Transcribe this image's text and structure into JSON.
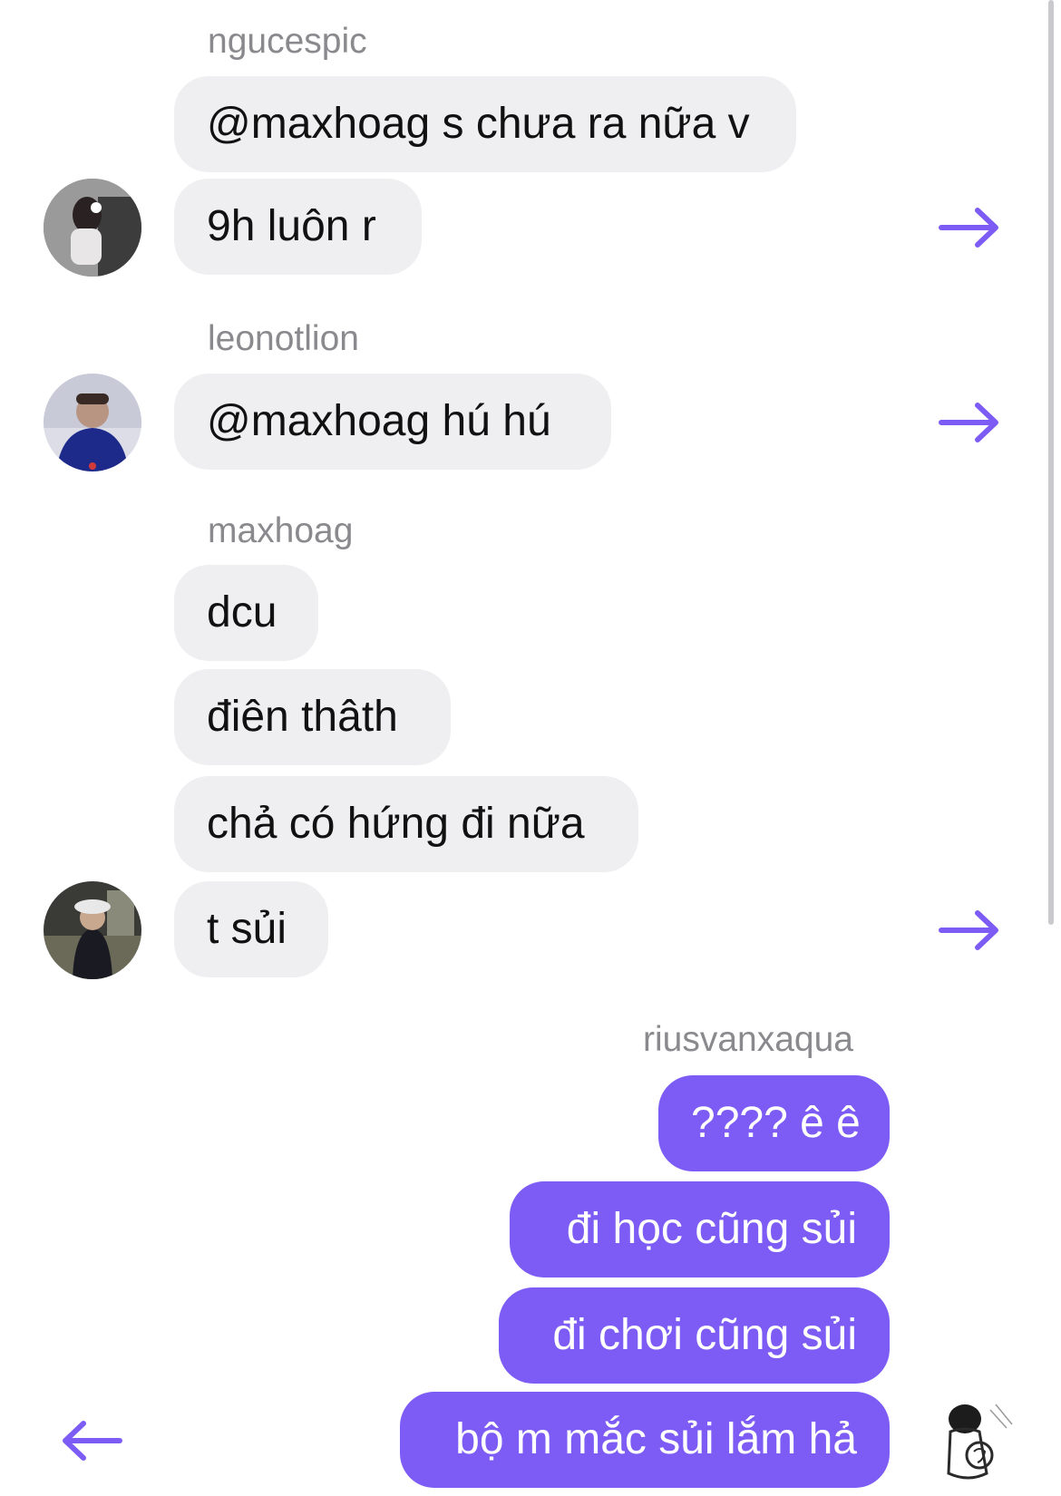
{
  "colors": {
    "accent": "#7c5cf4",
    "incoming_bubble": "#efeff1",
    "sender_name": "#8a8a8e"
  },
  "groups": [
    {
      "sender": "ngucespic",
      "messages": [
        "@maxhoag s chưa ra nữa v",
        "9h luôn r"
      ]
    },
    {
      "sender": "leonotlion",
      "messages": [
        "@maxhoag hú hú"
      ]
    },
    {
      "sender": "maxhoag",
      "messages": [
        "dcu",
        "điên thâth",
        "chả có hứng đi nữa",
        "t sủi"
      ]
    },
    {
      "sender": "riusvanxaqua",
      "messages": [
        "???? ê ê",
        "đi học cũng sủi",
        "đi chơi cũng sủi",
        "bộ m mắc sủi lắm hả"
      ]
    }
  ],
  "icons": {
    "share": "arrow-right-icon",
    "reply": "arrow-left-icon"
  }
}
